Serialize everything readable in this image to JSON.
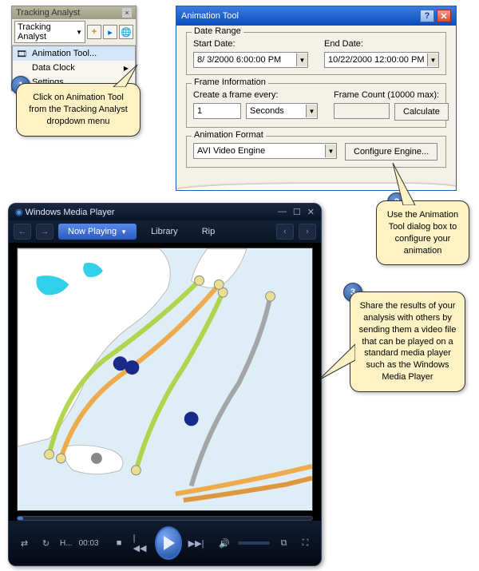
{
  "tracking_analyst": {
    "title": "Tracking Analyst",
    "dropdown_label": "Tracking Analyst",
    "menu": {
      "animation_tool": "Animation Tool...",
      "data_clock": "Data Clock",
      "settings": "Settings..."
    }
  },
  "callouts": {
    "c1": "Click on Animation Tool from the Tracking Analyst dropdown menu",
    "c2": "Use the Animation Tool dialog box to configure your animation",
    "c3": "Share the results of your analysis with others by sending them a video file that can be played on a standard media player such as the Windows Media Player"
  },
  "badges": {
    "b1": "1",
    "b2": "2",
    "b3": "3"
  },
  "animation_tool": {
    "title": "Animation Tool",
    "date_range": {
      "legend": "Date Range",
      "start_label": "Start Date:",
      "start_value": "8/ 3/2000   6:00:00 PM",
      "end_label": "End Date:",
      "end_value": "10/22/2000 12:00:00 PM"
    },
    "frame_info": {
      "legend": "Frame Information",
      "create_label": "Create a frame every:",
      "create_value": "1",
      "unit_value": "Seconds",
      "count_label": "Frame Count (10000 max):",
      "count_value": "",
      "calculate": "Calculate"
    },
    "format": {
      "legend": "Animation Format",
      "engine_value": "AVI Video Engine",
      "configure": "Configure Engine..."
    }
  },
  "wmp": {
    "title": "Windows Media Player",
    "tabs": {
      "now_playing": "Now Playing",
      "library": "Library",
      "rip": "Rip"
    },
    "time_label": "H...",
    "time_value": "00:03"
  }
}
